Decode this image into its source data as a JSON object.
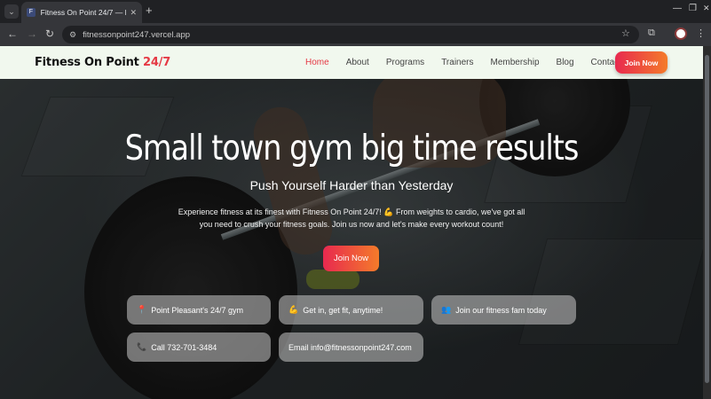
{
  "browser": {
    "tab_title": "Fitness On Point 24/7 — Point Pl",
    "url": "fitnessonpoint247.vercel.app"
  },
  "header": {
    "logo_main": "Fitness On Point",
    "logo_accent": "24/7",
    "nav": [
      "Home",
      "About",
      "Programs",
      "Trainers",
      "Membership",
      "Blog",
      "Contact"
    ],
    "active_nav": "Home",
    "join_label": "Join Now"
  },
  "hero": {
    "title": "Small town gym big time results",
    "subtitle": "Push Yourself Harder than Yesterday",
    "description": "Experience fitness at its finest with Fitness On Point 24/7! 💪 From weights to cardio, we've got all you need to crush your fitness goals. Join us now and let's make every workout count!",
    "join_label": "Join Now"
  },
  "info_chips": [
    {
      "icon": "📍",
      "text": "Point Pleasant's 24/7 gym"
    },
    {
      "icon": "💪",
      "text": "Get in, get fit, anytime!"
    },
    {
      "icon": "👥",
      "text": "Join our fitness fam today"
    },
    {
      "icon": "📞",
      "text": "Call 732-701-3484"
    },
    {
      "icon": "",
      "text": "Email info@fitnessonpoint247.com"
    }
  ],
  "colors": {
    "accent": "#e53944",
    "button_gradient_start": "#e8294f",
    "button_gradient_end": "#f47b2a",
    "header_bg": "#f1f8ee"
  }
}
